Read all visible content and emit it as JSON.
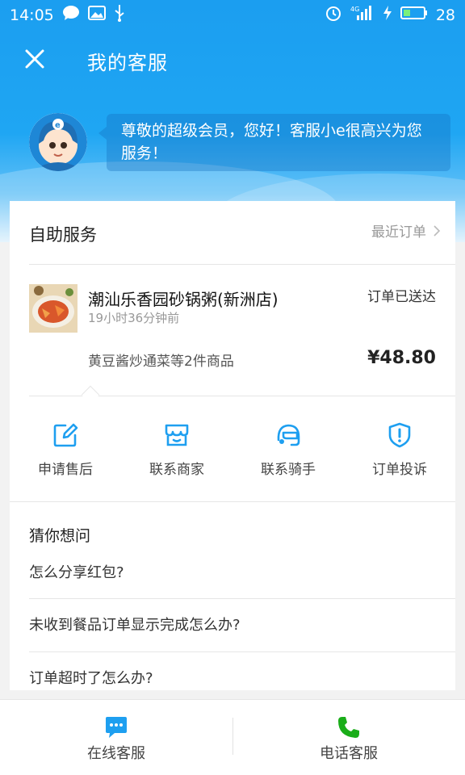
{
  "status_bar": {
    "time": "14:05",
    "battery_level": "28",
    "network": "4G"
  },
  "nav": {
    "title": "我的客服"
  },
  "greeting": {
    "text": "尊敬的超级会员，您好！客服小e很高兴为您服务！"
  },
  "self_service": {
    "title": "自助服务",
    "recent_orders_label": "最近订单",
    "order": {
      "shop_name": "潮汕乐香园砂锅粥(新洲店)",
      "time_ago": "19小时36分钟前",
      "status": "订单已送达",
      "items": "黄豆酱炒通菜等2件商品",
      "price": "¥48.80"
    },
    "actions": [
      {
        "label": "申请售后",
        "icon": "edit-icon"
      },
      {
        "label": "联系商家",
        "icon": "shop-icon"
      },
      {
        "label": "联系骑手",
        "icon": "rider-helmet-icon"
      },
      {
        "label": "订单投诉",
        "icon": "complaint-shield-icon"
      }
    ]
  },
  "faq": {
    "title": "猜你想问",
    "items": [
      "怎么分享红包?",
      "未收到餐品订单显示完成怎么办?",
      "订单超时了怎么办?"
    ]
  },
  "bottom_bar": {
    "online_label": "在线客服",
    "phone_label": "电话客服"
  },
  "colors": {
    "accent": "#1e9ff0",
    "phone_green": "#1aad19",
    "header_blue": "#1b9ef0"
  }
}
